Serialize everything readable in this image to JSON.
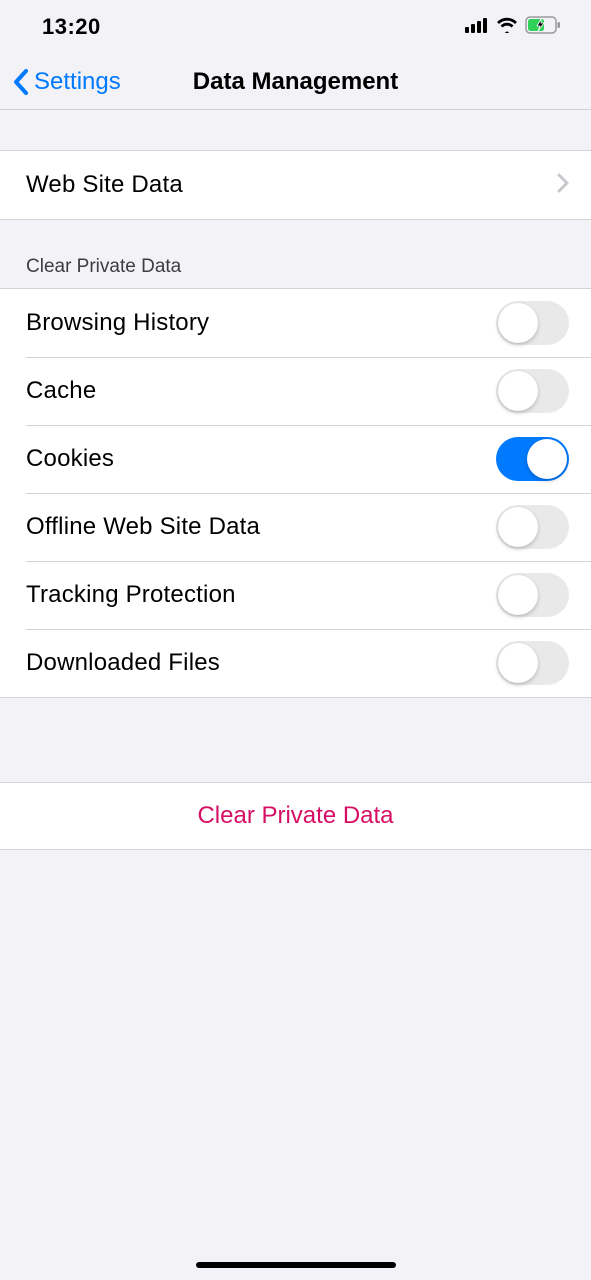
{
  "status": {
    "time": "13:20"
  },
  "nav": {
    "back_label": "Settings",
    "title": "Data Management"
  },
  "website_row": {
    "label": "Web Site Data"
  },
  "clear_section": {
    "header": "Clear Private Data",
    "items": [
      {
        "label": "Browsing History",
        "on": false
      },
      {
        "label": "Cache",
        "on": false
      },
      {
        "label": "Cookies",
        "on": true
      },
      {
        "label": "Offline Web Site Data",
        "on": false
      },
      {
        "label": "Tracking Protection",
        "on": false
      },
      {
        "label": "Downloaded Files",
        "on": false
      }
    ]
  },
  "action": {
    "label": "Clear Private Data"
  }
}
